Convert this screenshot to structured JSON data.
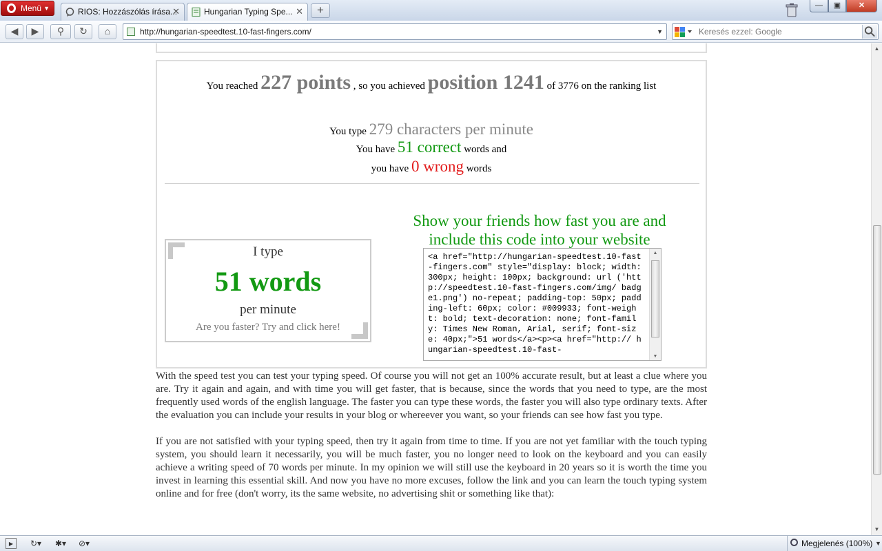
{
  "browser": {
    "menu_label": "Menü",
    "tabs": [
      {
        "title": "RIOS: Hozzászólás írása..."
      },
      {
        "title": "Hungarian Typing Spe..."
      }
    ],
    "new_tab": "+",
    "address": "http://hungarian-speedtest.10-fast-fingers.com/",
    "search_placeholder": "Keresés ezzel: Google",
    "status_zoom": "Megjelenés (100%)"
  },
  "result": {
    "reached_prefix": "You reached",
    "points": "227 points",
    "achieved_text": ", so you achieved",
    "position": "position 1241",
    "ranking_suffix": "of 3776 on the ranking list",
    "type_prefix": "You type",
    "cpm": "279 characters per minute",
    "have_prefix_1": "You have",
    "correct": "51 correct",
    "correct_suffix": "words and",
    "have_prefix_2": "you have",
    "wrong": "0 wrong",
    "wrong_suffix": "words"
  },
  "badge": {
    "i_type": "I type",
    "words": "51 words",
    "per_minute": "per minute",
    "cta": "Are you faster? Try and click here!"
  },
  "share": {
    "heading": "Show your friends how fast you are and include this code into your website",
    "code": "<a href=\"http://hungarian-speedtest.10-fast-fingers.com\" style=\"display: block; width: 300px; height: 100px; background: url ('http://speedtest.10-fast-fingers.com/img/ badge1.png') no-repeat; padding-top: 50px; padding-left: 60px; color: #009933; font-weight: bold; text-decoration: none; font-family: Times New Roman, Arial, serif; font-size: 40px;\">51 words</a><p><a href=\"http:// hungarian-speedtest.10-fast-"
  },
  "content": {
    "paragraph_1": "With the speed test you can test your typing speed. Of course you will not get an 100% accurate result, but at least a clue where you are. Try it again and again, and with time you will get faster, that is because, since the words that you need to type, are the most frequently used words of the english language. The faster you can type these words, the faster you will also type ordinary texts. After the evaluation you can include your results in your blog or whereever you want, so your friends can see how fast you type.",
    "paragraph_2": "If you are not satisfied with your typing speed, then try it again from time to time. If you are not yet familiar with the touch typing system, you should learn it necessarily, you will be much faster, you no longer need to look on the keyboard and you can easily achieve a writing speed of 70 words per minute. In my opinion we will still use the keyboard in 20 years so it is worth the time you invest in learning this essential skill. And now you have no more excuses, follow the link and you can learn the touch typing system online and for free (don't worry, its the same website, no advertising shit or something like that):"
  },
  "colors": {
    "green": "#129912",
    "red": "#e21b1b",
    "grey": "#7a7a7a",
    "opera_red": "#c41a1a"
  }
}
